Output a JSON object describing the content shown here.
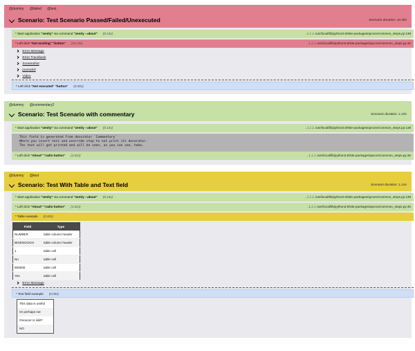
{
  "scenarios": [
    {
      "tags": [
        "@dummy",
        "@failed",
        "@test"
      ],
      "title": "Scenario: Test Scenario Passed/Failed/Unexecuted",
      "duration": "Scenario duration: 10.30s",
      "steps": [
        {
          "prefix": "* Start application ",
          "bold": "\"zenity\"",
          "mid": " via command ",
          "bold2": "\"zenity --about\"",
          "time": "(0.14s)",
          "location": "../../../../usr/local/lib/python3.9/site-packages/qecore/common_steps.py:138",
          "status": "passed"
        },
        {
          "prefix": "* Left click ",
          "bold": "\"Not existing\"",
          "mid": " ",
          "bold2": "\"button\"",
          "time": "(10.15s)",
          "location": "../../../../usr/local/lib/python3.9/site-packages/qecore/common_steps.py:45",
          "status": "failed"
        },
        {
          "prefix": "* Left click ",
          "bold": "\"Not executed\"",
          "mid": " ",
          "bold2": "\"button\"",
          "time": "(0.00s)",
          "location": "",
          "status": "untested"
        }
      ],
      "links": [
        "Error Message",
        "Error Traceback",
        "Screenshot",
        "journalctl",
        "Video"
      ],
      "background": "#e27f8e"
    },
    {
      "tags": [
        "@dummy",
        "@commentary2"
      ],
      "title": "Scenario: Test Scenario with commentary",
      "duration": "Scenario duration: 1.15s",
      "steps": [
        {
          "prefix": "* Start application ",
          "bold": "\"zenity\"",
          "mid": " via command ",
          "bold2": "\"zenity --about\"",
          "time": "(0.14s)",
          "location": "../../../../usr/local/lib/python3.9/site-packages/qecore/common_steps.py:138",
          "status": "passed"
        },
        {
          "prefix": "* Left click ",
          "bold": "\"About\"",
          "mid": " ",
          "bold2": "\"radio button\"",
          "time": "(1.01s)",
          "location": "../../../../usr/local/lib/python3.9/site-packages/qecore/common_steps.py:45",
          "status": "passed"
        }
      ],
      "commentary": [
        "This field is generated from decorator `Commentary`",
        "Where you insert text and override step to not print its decorator.",
        "The text will get printed and will be seen, as you can see, haha."
      ],
      "background": "#c6e0a6"
    },
    {
      "tags": [
        "@dummy",
        "@test"
      ],
      "title": "Scenario: Test With Table and Text field",
      "duration": "Scenario duration: 1.14s",
      "steps": [
        {
          "prefix": "* Start application ",
          "bold": "\"zenity\"",
          "mid": " via command ",
          "bold2": "\"zenity --about\"",
          "time": "(0.13s)",
          "location": "../../../../usr/local/lib/python3.9/site-packages/qecore/common_steps.py:138",
          "status": "passed"
        },
        {
          "prefix": "* Left click ",
          "bold": "\"About\"",
          "mid": " ",
          "bold2": "\"radio button\"",
          "time": "(1.01s)",
          "location": "../../../../usr/local/lib/python3.9/site-packages/qecore/common_steps.py:45",
          "status": "passed"
        },
        {
          "prefix": "* Table example",
          "bold": "",
          "mid": "",
          "bold2": "",
          "time": "(0.00s)",
          "location": "",
          "status": "warning"
        },
        {
          "prefix": "* Text field example",
          "bold": "",
          "mid": "",
          "bold2": "",
          "time": "(0.00s)",
          "location": "",
          "status": "untested"
        }
      ],
      "table": {
        "headers": [
          "Field",
          "Type"
        ],
        "rows": [
          [
            "NUMBER",
            "table column header"
          ],
          [
            "BIGENOUGH",
            "table column header"
          ],
          [
            "1",
            "table cell"
          ],
          [
            "No",
            "table cell"
          ],
          [
            "900000",
            "table cell"
          ],
          [
            "Yes",
            "table cell"
          ]
        ]
      },
      "links": [
        "Error Message"
      ],
      "text_field": [
        "This data is useful",
        "Or perhaps not",
        "Oooooor is iiiiiit?",
        "NO"
      ],
      "background": "#e6ce3c"
    }
  ]
}
